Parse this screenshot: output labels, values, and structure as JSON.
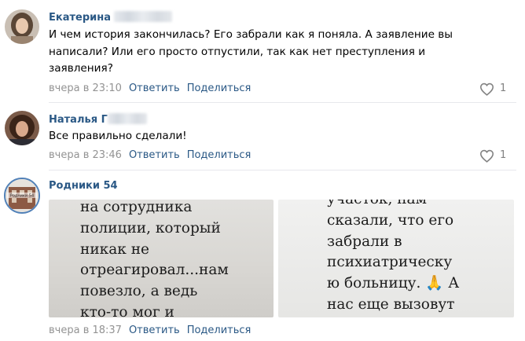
{
  "comments": [
    {
      "author": "Екатерина",
      "lines": [
        "И чем история закончилась? Его забрали как я поняла. А заявление вы",
        "написали? Или его просто отпустили, так как нет преступления и",
        "заявления?"
      ],
      "time": "вчера в 23:10",
      "reply_label": "Ответить",
      "share_label": "Поделиться",
      "likes": "1"
    },
    {
      "author": "Наталья Г",
      "lines": [
        "Все правильно сделали!"
      ],
      "time": "вчера в 23:46",
      "reply_label": "Ответить",
      "share_label": "Поделиться",
      "likes": "1"
    },
    {
      "author": "Родники 54",
      "avatar_text": "Родники 54",
      "time": "вчера в 18:37",
      "reply_label": "Ответить",
      "share_label": "Поделиться",
      "photos": [
        {
          "lines": [
            "на сотрудника",
            "полиции, который",
            "никак не",
            "отреагировал...нам",
            "повезло, а ведь",
            "кто-то мог и"
          ]
        },
        {
          "lines": [
            "участок,  нам",
            "сказали, что его",
            "забрали в",
            "психиатрическу",
            "ю больницу. 🙏 А",
            "нас еще вызовут"
          ]
        }
      ]
    }
  ],
  "icons": {
    "like": "heart-outline-icon"
  },
  "colors": {
    "link": "#2a5885",
    "meta": "#939393",
    "separator": "#e7e8ec"
  }
}
